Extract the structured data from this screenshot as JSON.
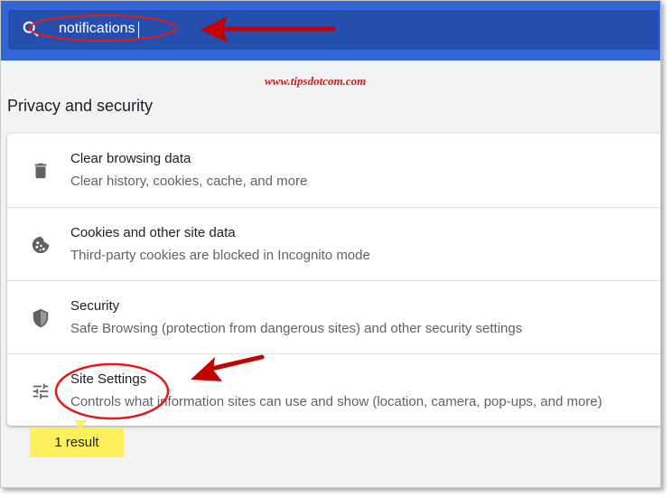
{
  "search": {
    "value": "notifications"
  },
  "watermark": {
    "text": "www.tipsdotcom.com"
  },
  "section": {
    "title": "Privacy and security"
  },
  "rows": [
    {
      "title": "Clear browsing data",
      "subtitle": "Clear history, cookies, cache, and more",
      "icon": "trash-icon"
    },
    {
      "title": "Cookies and other site data",
      "subtitle": "Third-party cookies are blocked in Incognito mode",
      "icon": "cookie-icon"
    },
    {
      "title": "Security",
      "subtitle": "Safe Browsing (protection from dangerous sites) and other security settings",
      "icon": "shield-icon"
    },
    {
      "title": "Site Settings",
      "subtitle": "Controls what information sites can use and show (location, camera, pop-ups, and more)",
      "icon": "tune-icon"
    }
  ],
  "results": {
    "label": "1 result"
  },
  "colors": {
    "header": "#3367d6",
    "search_box": "#254fae",
    "annotation_red": "#e21a1a",
    "badge_yellow": "#fef05c"
  }
}
